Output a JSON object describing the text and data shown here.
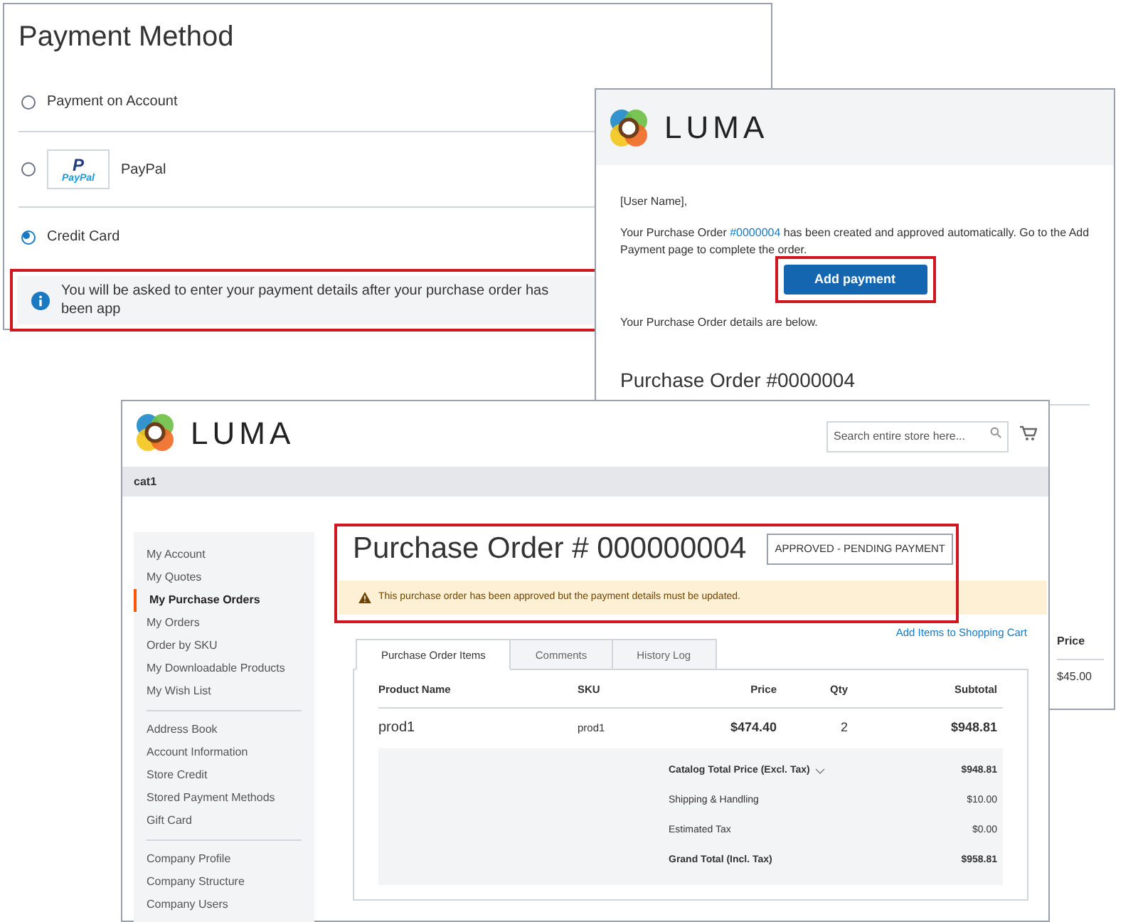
{
  "payment_window": {
    "title": "Payment Method",
    "options": [
      {
        "kind": "plain",
        "label": "Payment on Account",
        "selected": false
      },
      {
        "kind": "logo",
        "label": "PayPal",
        "logo_mark": "P",
        "logo_text": "PayPal",
        "selected": false
      },
      {
        "kind": "plain",
        "label": "Credit Card",
        "selected": true
      }
    ],
    "notice": {
      "text": "You will be asked to enter your payment details after your purchase order has been app",
      "highlighted": true
    }
  },
  "email_window": {
    "brand": "LUMA",
    "greeting": "[User Name],",
    "message_before": "Your Purchase Order ",
    "order_link": "#0000004",
    "message_after": " has been created and approved automatically. Go to the Add Payment page to complete the order.",
    "button": {
      "label": "Add payment",
      "highlighted": true
    },
    "details_note": "Your Purchase Order details are below.",
    "order_heading": "Purchase Order #0000004",
    "column": "Price",
    "cell": "$45.00"
  },
  "order_window": {
    "brand": "LUMA",
    "search": {
      "placeholder": "Search entire store here..."
    },
    "nav": "cat1",
    "sidebar": [
      [
        {
          "label": "My Account",
          "selected": false
        },
        {
          "label": "My Quotes",
          "selected": false
        },
        {
          "label": "My Purchase Orders",
          "selected": true
        },
        {
          "label": "My Orders",
          "selected": false
        },
        {
          "label": "Order by SKU",
          "selected": false
        },
        {
          "label": "My Downloadable Products",
          "selected": false
        },
        {
          "label": "My Wish List",
          "selected": false
        }
      ],
      [
        {
          "label": "Address Book",
          "selected": false
        },
        {
          "label": "Account Information",
          "selected": false
        },
        {
          "label": "Store Credit",
          "selected": false
        },
        {
          "label": "Stored Payment Methods",
          "selected": false
        },
        {
          "label": "Gift Card",
          "selected": false
        }
      ],
      [
        {
          "label": "Company Profile",
          "selected": false
        },
        {
          "label": "Company Structure",
          "selected": false
        },
        {
          "label": "Company Users",
          "selected": false
        }
      ]
    ],
    "title": "Purchase Order # 000000004",
    "status": "APPROVED - PENDING PAYMENT",
    "highlighted": true,
    "alert": "This purchase order has been approved but the payment details must be updated.",
    "link": "Add Items to Shopping Cart",
    "tabs": [
      {
        "label": "Purchase Order Items",
        "selected": true
      },
      {
        "label": "Comments",
        "selected": false
      },
      {
        "label": "History Log",
        "selected": false
      }
    ],
    "table": {
      "columns": [
        "Product Name",
        "SKU",
        "Price",
        "Qty",
        "Subtotal"
      ],
      "rows": [
        [
          "prod1",
          "prod1",
          "$474.40",
          "2",
          "$948.81"
        ]
      ]
    },
    "totals": [
      {
        "label": "Catalog Total Price (Excl. Tax)",
        "value": "$948.81",
        "bold": true,
        "expandable": true
      },
      {
        "label": "Shipping & Handling",
        "value": "$10.00",
        "bold": false,
        "expandable": false
      },
      {
        "label": "Estimated Tax",
        "value": "$0.00",
        "bold": false,
        "expandable": false
      },
      {
        "label": "Grand Total (Incl. Tax)",
        "value": "$958.81",
        "bold": true,
        "expandable": false
      }
    ]
  }
}
